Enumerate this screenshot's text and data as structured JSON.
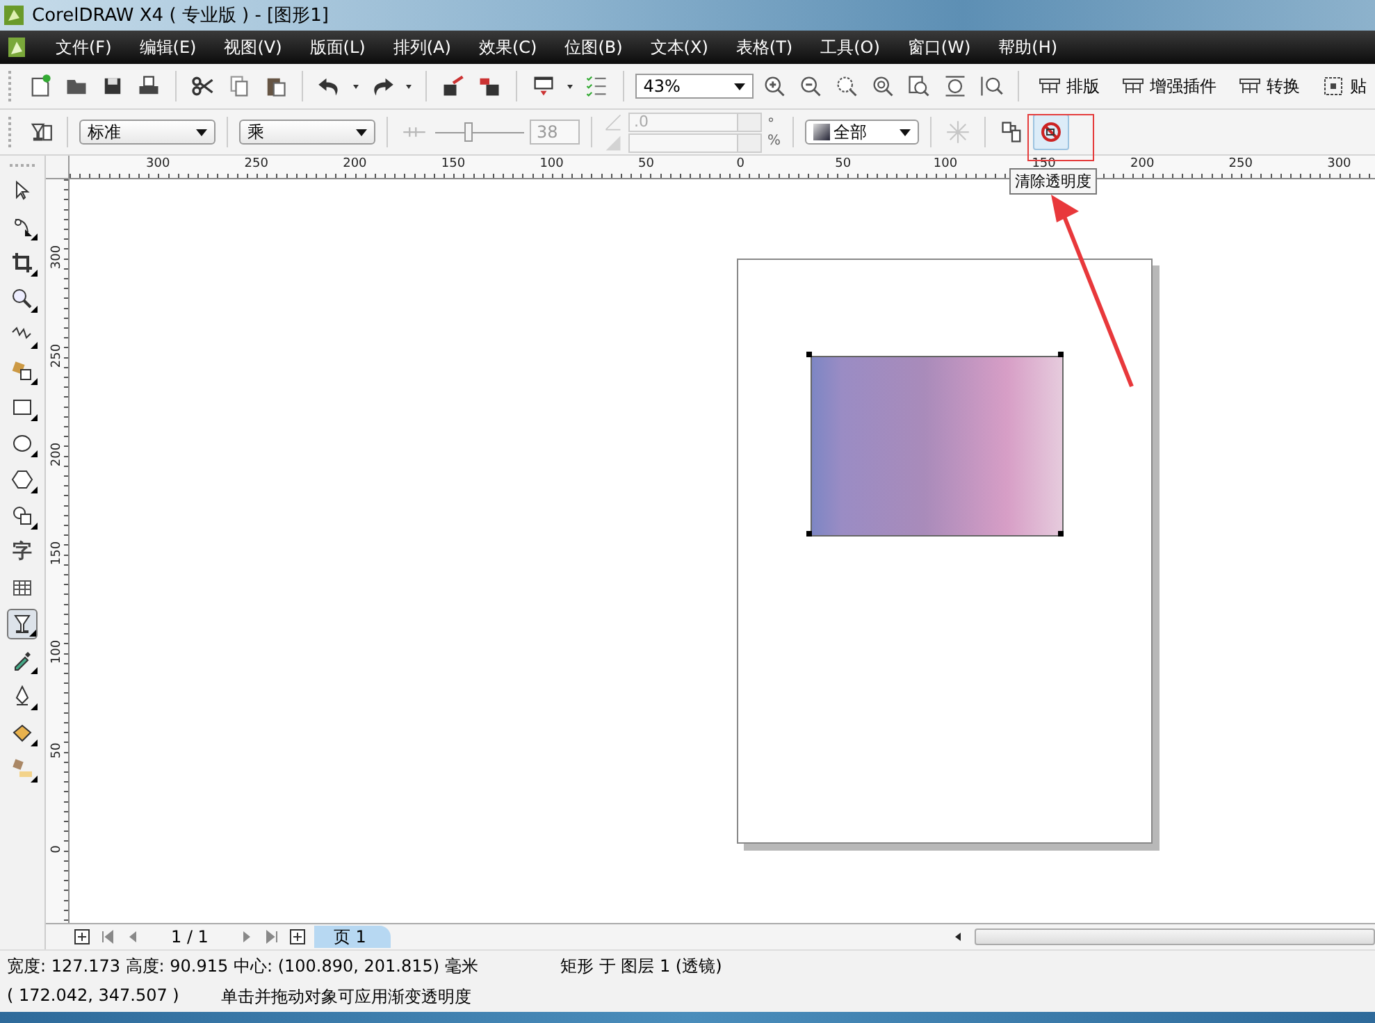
{
  "window": {
    "title": "CorelDRAW X4 ( 专业版 ) - [图形1]"
  },
  "menu": [
    "文件(F)",
    "编辑(E)",
    "视图(V)",
    "版面(L)",
    "排列(A)",
    "效果(C)",
    "位图(B)",
    "文本(X)",
    "表格(T)",
    "工具(O)",
    "窗口(W)",
    "帮助(H)"
  ],
  "standard_toolbar": {
    "zoom": "43%",
    "buttons": [
      "排版",
      "增强插件",
      "转换",
      "贴"
    ]
  },
  "property_bar": {
    "merge_mode": "标准",
    "operation": "乘",
    "slider": {
      "level": 0.38
    },
    "value": "38",
    "angle": ".0",
    "degree_unit": "°",
    "percent_unit": "%",
    "target": "全部",
    "tooltip": "清除透明度"
  },
  "toolbox": [
    {
      "kind": "pick",
      "selected": false
    },
    {
      "kind": "shape",
      "selected": false
    },
    {
      "kind": "crop",
      "selected": false
    },
    {
      "kind": "zoom",
      "selected": false
    },
    {
      "kind": "freehand",
      "selected": false
    },
    {
      "kind": "smartfill",
      "selected": false
    },
    {
      "kind": "rectangle",
      "selected": false
    },
    {
      "kind": "ellipse",
      "selected": false
    },
    {
      "kind": "polygon",
      "selected": false
    },
    {
      "kind": "basic",
      "selected": false
    },
    {
      "kind": "text",
      "label": "字",
      "selected": false
    },
    {
      "kind": "table",
      "selected": false
    },
    {
      "kind": "transparency",
      "selected": true
    },
    {
      "kind": "eyedropper",
      "selected": false
    },
    {
      "kind": "outline",
      "selected": false
    },
    {
      "kind": "fill",
      "selected": false
    },
    {
      "kind": "interactive",
      "selected": false
    }
  ],
  "rulers": {
    "horizontal": [
      "300",
      "250",
      "200",
      "150",
      "100",
      "50",
      "0",
      "50",
      "100",
      "150",
      "200",
      "250",
      "300"
    ],
    "vertical": [
      "300",
      "250",
      "200",
      "150",
      "100",
      "50",
      "0"
    ]
  },
  "page_nav": {
    "pages": "1 / 1",
    "tabs": [
      {
        "label": "页 1",
        "selected": true
      }
    ]
  },
  "status_bar": {
    "size": "宽度: 127.173  高度: 90.915  中心: (100.890, 201.815)  毫米",
    "object": "矩形 于 图层 1 (透镜)",
    "cursor": "( 172.042, 347.507 )",
    "hint": "单击并拖动对象可应用渐变透明度"
  }
}
